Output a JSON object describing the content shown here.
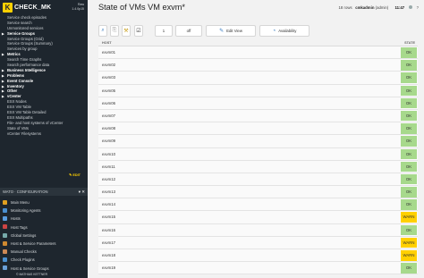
{
  "brand": {
    "logo_letter": "K",
    "name": "CHECK_MK",
    "version_line1": "Raw",
    "version_line2": "1.4.0p15"
  },
  "sidebar": {
    "items": [
      {
        "label": "Service check episodes",
        "level": "sub"
      },
      {
        "label": "Service search",
        "level": "sub"
      },
      {
        "label": "Unmonitored services",
        "level": "sub"
      },
      {
        "label": "Service Groups",
        "level": "head"
      },
      {
        "label": "Service Groups (Grid)",
        "level": "sub"
      },
      {
        "label": "Service Groups (Summary)",
        "level": "sub"
      },
      {
        "label": "Services by group",
        "level": "sub"
      },
      {
        "label": "Metrics",
        "level": "head"
      },
      {
        "label": "Search Time Graphs",
        "level": "sub"
      },
      {
        "label": "Search performance data",
        "level": "sub"
      },
      {
        "label": "Business Intelligence",
        "level": "head"
      },
      {
        "label": "Problems",
        "level": "head"
      },
      {
        "label": "Event Console",
        "level": "head"
      },
      {
        "label": "Inventory",
        "level": "head"
      },
      {
        "label": "Other",
        "level": "head"
      },
      {
        "label": "vCenter",
        "level": "head"
      },
      {
        "label": "ESX Nodes",
        "level": "sub"
      },
      {
        "label": "ESX VM Table",
        "level": "sub"
      },
      {
        "label": "ESX VM Table Detailed",
        "level": "sub"
      },
      {
        "label": "ESX Multipaths",
        "level": "sub"
      },
      {
        "label": "File- and host systems of vCenter",
        "level": "sub"
      },
      {
        "label": "State of VMs",
        "level": "sub"
      },
      {
        "label": "vCenter Filesystems",
        "level": "sub"
      }
    ],
    "edit_label": "EDIT",
    "wato_title": "WATO · CONFIGURATION",
    "wato_items": [
      {
        "label": "Main Menu",
        "color": "#e0a020"
      },
      {
        "label": "Monitoring Agents",
        "color": "#4a8fd0"
      },
      {
        "label": "Hosts",
        "color": "#5a9de0"
      },
      {
        "label": "Host Tags",
        "color": "#c44"
      },
      {
        "label": "Global Settings",
        "color": "#7aa"
      },
      {
        "label": "Host & Service Parameters",
        "color": "#d08a30"
      },
      {
        "label": "Manual Checks",
        "color": "#c85"
      },
      {
        "label": "Check Plugins",
        "color": "#4a8fd0"
      },
      {
        "label": "Host & Service Groups",
        "color": "#6aa0d8"
      }
    ],
    "footer": "© MATHIAS KETTNER"
  },
  "header": {
    "title": "State of VMs VM exvm*",
    "age": "18 rows",
    "user": "cmkadmin",
    "role": "(admin)",
    "clock": "11:47"
  },
  "toolbar": {
    "search_icon": "search-icon",
    "refresh_value": "1",
    "refresh_state": "off",
    "edit_view_label": "Edit View",
    "availability_label": "Availability"
  },
  "table": {
    "headers": [
      "HOST",
      "STATE"
    ],
    "rows": [
      {
        "host": "exvm01",
        "state": "OK"
      },
      {
        "host": "exvm02",
        "state": "OK"
      },
      {
        "host": "exvm03",
        "state": "OK"
      },
      {
        "host": "exvm05",
        "state": "OK"
      },
      {
        "host": "exvm06",
        "state": "OK"
      },
      {
        "host": "exvm07",
        "state": "OK"
      },
      {
        "host": "exvm08",
        "state": "OK"
      },
      {
        "host": "exvm09",
        "state": "OK"
      },
      {
        "host": "exvm10",
        "state": "OK"
      },
      {
        "host": "exvm11",
        "state": "OK"
      },
      {
        "host": "exvm12",
        "state": "OK"
      },
      {
        "host": "exvm13",
        "state": "OK"
      },
      {
        "host": "exvm14",
        "state": "OK"
      },
      {
        "host": "exvm15",
        "state": "WARN"
      },
      {
        "host": "exvm16",
        "state": "OK"
      },
      {
        "host": "exvm17",
        "state": "WARN"
      },
      {
        "host": "exvm18",
        "state": "WARN"
      },
      {
        "host": "exvm19",
        "state": "OK"
      }
    ]
  },
  "colors": {
    "ok": "#a7d98c",
    "warn": "#ffd000",
    "sidebar": "#1e262e",
    "accent": "#ffd000"
  }
}
